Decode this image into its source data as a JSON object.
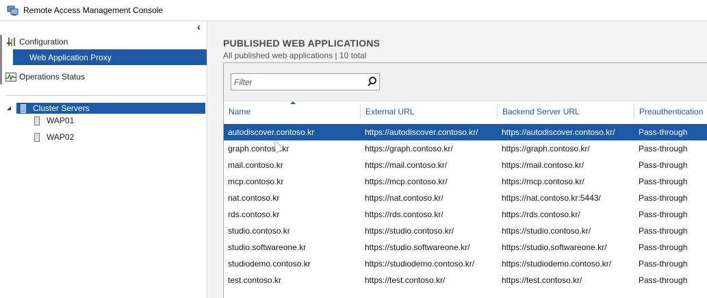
{
  "window": {
    "title": "Remote Access Management Console"
  },
  "nav": {
    "collapse": "‹",
    "configuration": "Configuration",
    "web_application_proxy": "Web Application Proxy",
    "operations_status": "Operations Status"
  },
  "tree": {
    "cluster": "Cluster Servers",
    "servers": [
      "WAP01",
      "WAP02"
    ]
  },
  "main": {
    "heading": "PUBLISHED WEB APPLICATIONS",
    "subheading": "All published web applications | 10 total",
    "filter_placeholder": "Filter",
    "columns": [
      "Name",
      "External URL",
      "Backend Server URL",
      "Preauthentication"
    ],
    "rows": [
      [
        "autodiscover.contoso.kr",
        "https://autodiscover.contoso.kr/",
        "https://autodiscover.contoso.kr/",
        "Pass-through"
      ],
      [
        "graph.contoso.kr",
        "https://graph.contoso.kr/",
        "https://graph.contoso.kr/",
        "Pass-through"
      ],
      [
        "mail.contoso.kr",
        "https://mail.contoso.kr/",
        "https://mail.contoso.kr/",
        "Pass-through"
      ],
      [
        "mcp.contoso.kr",
        "https://mcp.contoso.kr/",
        "https://mcp.contoso.kr/",
        "Pass-through"
      ],
      [
        "nat.contoso.kr",
        "https://nat.contoso.kr/",
        "https://nat.contoso.kr:5443/",
        "Pass-through"
      ],
      [
        "rds.contoso.kr",
        "https://rds.contoso.kr/",
        "https://rds.contoso.kr/",
        "Pass-through"
      ],
      [
        "studio.contoso.kr",
        "https://studio.contoso.kr/",
        "https://studio.contoso.kr/",
        "Pass-through"
      ],
      [
        "studio.softwareone.kr",
        "https://studio.softwareone.kr/",
        "https://studio.softwareone.kr/",
        "Pass-through"
      ],
      [
        "studiodemo.contoso.kr",
        "https://studiodemo.contoso.kr/",
        "https://studiodemo.contoso.kr/",
        "Pass-through"
      ],
      [
        "test.contoso.kr",
        "https://test.contoso.kr/",
        "https://test.contoso.kr/",
        "Pass-through"
      ]
    ],
    "selected_row": 0
  },
  "colors": {
    "accent": "#1c5aa6",
    "pane_bg": "#f3f3f3"
  }
}
